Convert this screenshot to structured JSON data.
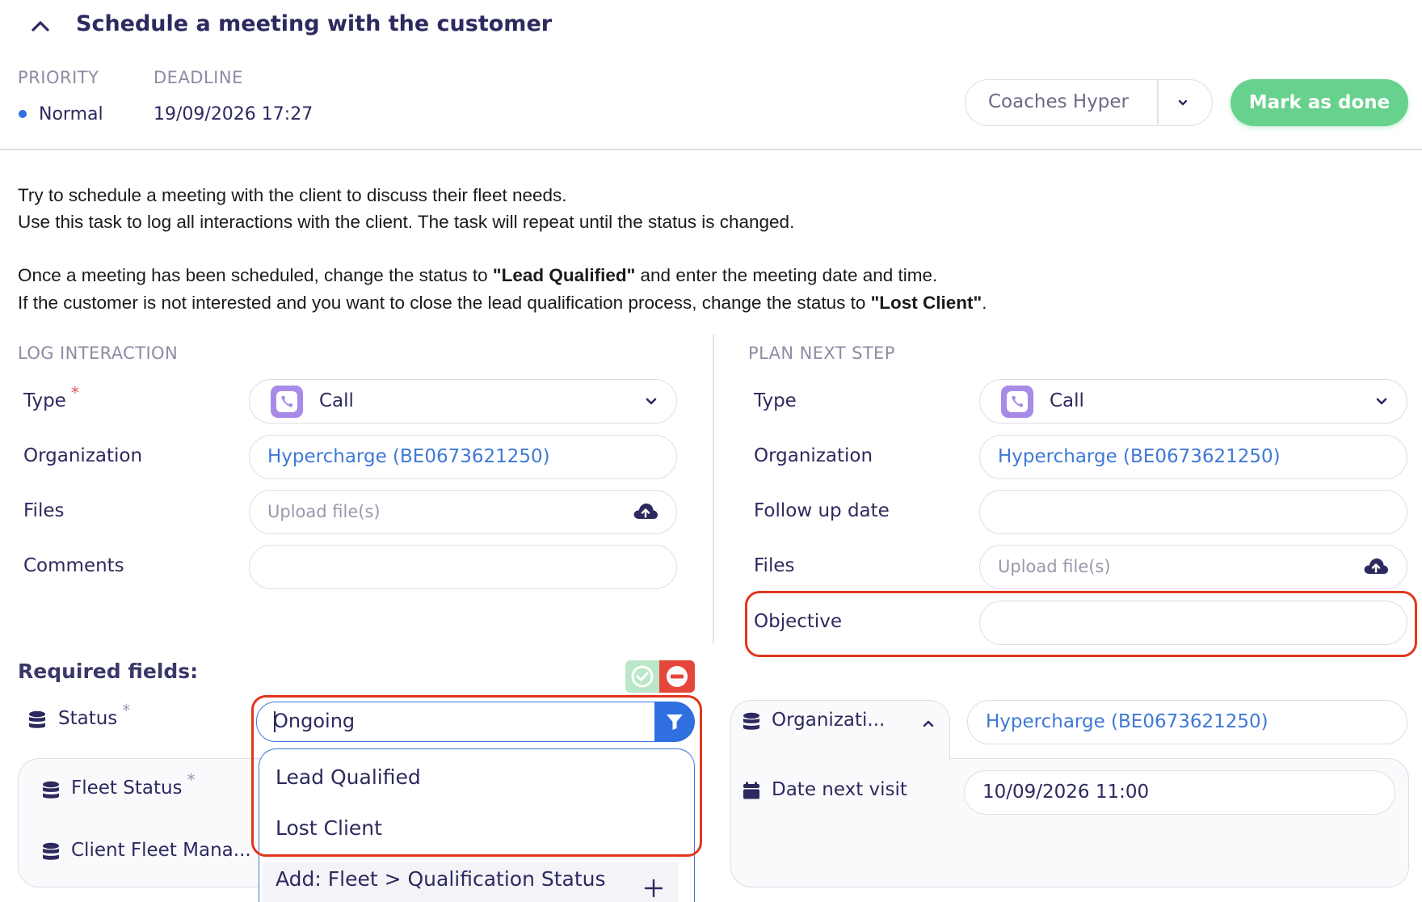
{
  "task": {
    "title": "Schedule a meeting with the customer",
    "priority_label": "PRIORITY",
    "priority_value": "Normal",
    "deadline_label": "DEADLINE",
    "deadline_value": "19/09/2026 17:27",
    "assignee": "Coaches Hyper",
    "mark_done": "Mark as done"
  },
  "description": {
    "line1": "Try to schedule a meeting with the client to discuss their fleet needs.",
    "line2": "Use this task to log all interactions with the client. The task will repeat until the status is changed.",
    "line3_pre": "Once a meeting has been scheduled, change the status to ",
    "line3_bold": "\"Lead Qualified\"",
    "line3_post": " and enter the meeting date and time.",
    "line4_pre": "If the customer is not interested and you want to close the lead qualification process, change the status to ",
    "line4_bold": "\"Lost Client\"",
    "line4_post": "."
  },
  "log_interaction": {
    "section_label": "LOG INTERACTION",
    "type_label": "Type",
    "type_required": "*",
    "type_value": "Call",
    "organization_label": "Organization",
    "organization_value": "Hypercharge (BE0673621250)",
    "files_label": "Files",
    "files_placeholder": "Upload file(s)",
    "comments_label": "Comments",
    "comments_value": ""
  },
  "plan_next_step": {
    "section_label": "PLAN NEXT STEP",
    "type_label": "Type",
    "type_value": "Call",
    "organization_label": "Organization",
    "organization_value": "Hypercharge (BE0673621250)",
    "follow_up_label": "Follow up date",
    "follow_up_value": "",
    "files_label": "Files",
    "files_placeholder": "Upload file(s)",
    "objective_label": "Objective",
    "objective_value": ""
  },
  "required_fields": {
    "title": "Required fields:",
    "status_label": "Status",
    "status_required": "*",
    "status_value": "Ongoing",
    "status_options": [
      "Lead Qualified",
      "Lost Client"
    ],
    "add_option": "Add: Fleet > Qualification Status",
    "fleet_status_label": "Fleet Status",
    "fleet_status_required": "*",
    "client_fleet_label": "Client Fleet Mana...",
    "organization_label": "Organizati...",
    "organization_value": "Hypercharge (BE0673621250)",
    "date_next_visit_label": "Date next visit",
    "date_next_visit_value": "10/09/2026 11:00"
  },
  "colors": {
    "accent_blue": "#2f6fe0",
    "link_blue": "#3f78d6",
    "done_green": "#67d18e",
    "highlight_red": "#e2361d",
    "text_navy": "#2c2a5e",
    "call_purple": "#a88be8"
  }
}
